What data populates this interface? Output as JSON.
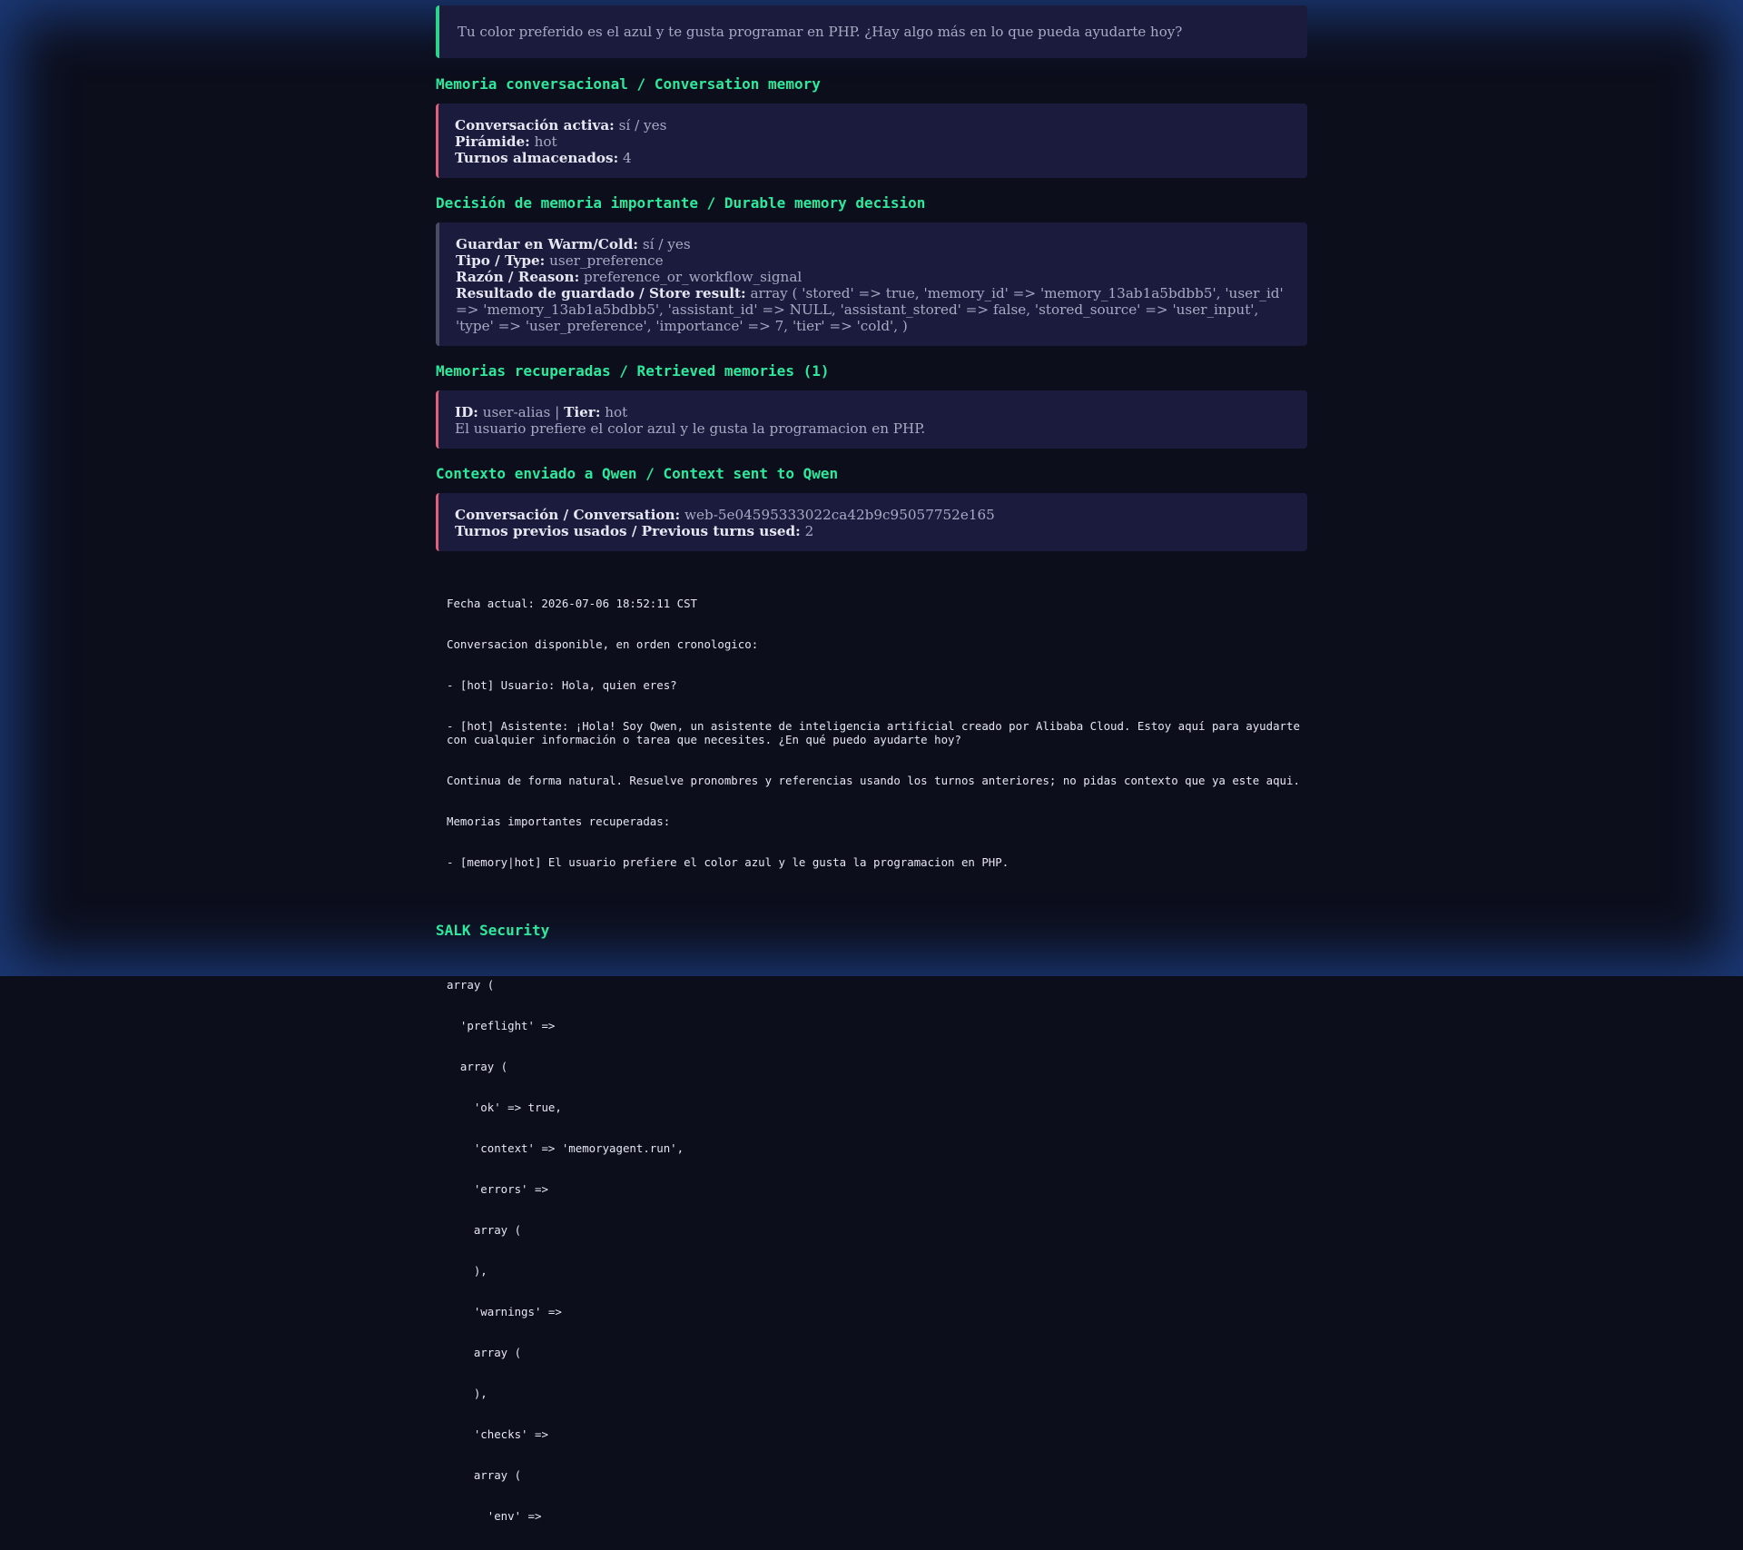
{
  "assistant_reply": "Tu color preferido es el azul y te gusta programar en PHP. ¿Hay algo más en lo que pueda ayudarte hoy?",
  "conversation_memory": {
    "heading": "Memoria conversacional / Conversation memory",
    "active_label": "Conversación activa:",
    "active_value": "sí / yes",
    "pyramid_label": "Pirámide:",
    "pyramid_value": "hot",
    "turns_label": "Turnos almacenados:",
    "turns_value": "4"
  },
  "durable_memory": {
    "heading": "Decisión de memoria importante / Durable memory decision",
    "save_label": "Guardar en Warm/Cold:",
    "save_value": "sí / yes",
    "type_label": "Tipo / Type:",
    "type_value": "user_preference",
    "reason_label": "Razón / Reason:",
    "reason_value": "preference_or_workflow_signal",
    "result_label": "Resultado de guardado / Store result:",
    "result_value": "array ( 'stored' => true, 'memory_id' => 'memory_13ab1a5bdbb5', 'user_id' => 'memory_13ab1a5bdbb5', 'assistant_id' => NULL, 'assistant_stored' => false, 'stored_source' => 'user_input', 'type' => 'user_preference', 'importance' => 7, 'tier' => 'cold', )"
  },
  "retrieved_memories": {
    "heading": "Memorias recuperadas / Retrieved memories (1)",
    "id_label": "ID:",
    "id_value": "user-alias",
    "separator": "|",
    "tier_label": "Tier:",
    "tier_value": "hot",
    "text": "El usuario prefiere el color azul y le gusta la programacion en PHP."
  },
  "context_sent": {
    "heading": "Contexto enviado a Qwen / Context sent to Qwen",
    "conversation_label": "Conversación / Conversation:",
    "conversation_value": "web-5e04595333022ca42b9c95057752e165",
    "prev_turns_label": "Turnos previos usados / Previous turns used:",
    "prev_turns_value": "2",
    "prompt_lines": [
      "Fecha actual: 2026-07-06 18:52:11 CST",
      "Conversacion disponible, en orden cronologico:",
      "- [hot] Usuario: Hola, quien eres?",
      "- [hot] Asistente: ¡Hola! Soy Qwen, un asistente de inteligencia artificial creado por Alibaba Cloud. Estoy aquí para ayudarte con cualquier información o tarea que necesites. ¿En qué puedo ayudarte hoy?",
      "Continua de forma natural. Resuelve pronombres y referencias usando los turnos anteriores; no pidas contexto que ya este aqui.",
      "Memorias importantes recuperadas:",
      "- [memory|hot] El usuario prefiere el color azul y le gusta la programacion en PHP."
    ]
  },
  "security": {
    "heading": "SALK Security",
    "dump_lines": [
      "array (",
      "  'preflight' =>",
      "  array (",
      "    'ok' => true,",
      "    'context' => 'memoryagent.run',",
      "    'errors' =>",
      "    array (",
      "    ),",
      "    'warnings' =>",
      "    array (",
      "    ),",
      "    'checks' =>",
      "    array (",
      "      'env' =>"
    ]
  }
}
